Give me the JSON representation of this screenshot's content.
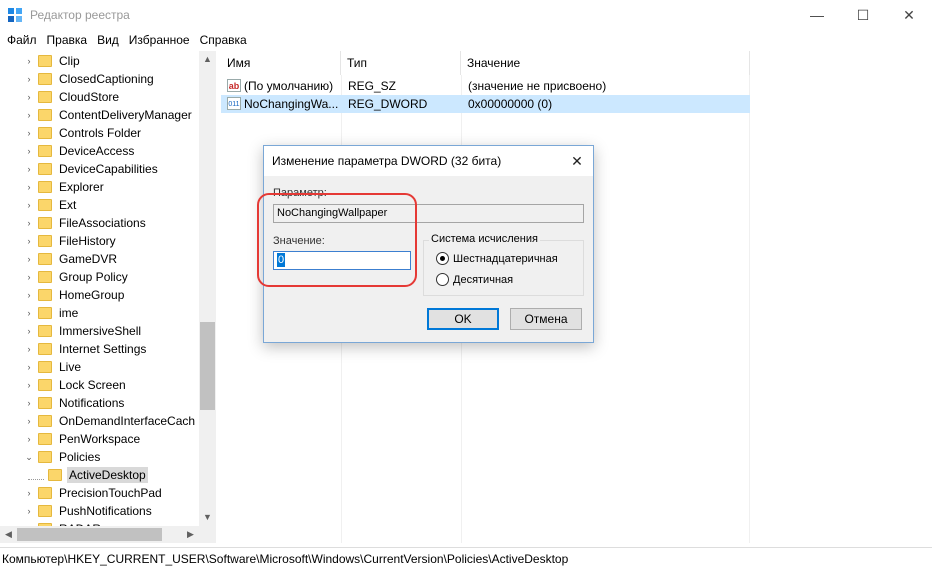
{
  "window": {
    "title": "Редактор реестра",
    "minimize_glyph": "—",
    "maximize_glyph": "☐",
    "close_glyph": "✕"
  },
  "menu": [
    "Файл",
    "Правка",
    "Вид",
    "Избранное",
    "Справка"
  ],
  "tree": {
    "items": [
      {
        "label": "Clip",
        "expander": "›"
      },
      {
        "label": "ClosedCaptioning",
        "expander": "›"
      },
      {
        "label": "CloudStore",
        "expander": "›"
      },
      {
        "label": "ContentDeliveryManager",
        "expander": "›"
      },
      {
        "label": "Controls Folder",
        "expander": "›"
      },
      {
        "label": "DeviceAccess",
        "expander": "›"
      },
      {
        "label": "DeviceCapabilities",
        "expander": "›"
      },
      {
        "label": "Explorer",
        "expander": "›"
      },
      {
        "label": "Ext",
        "expander": "›"
      },
      {
        "label": "FileAssociations",
        "expander": "›"
      },
      {
        "label": "FileHistory",
        "expander": "›"
      },
      {
        "label": "GameDVR",
        "expander": "›"
      },
      {
        "label": "Group Policy",
        "expander": "›"
      },
      {
        "label": "HomeGroup",
        "expander": "›"
      },
      {
        "label": "ime",
        "expander": "›"
      },
      {
        "label": "ImmersiveShell",
        "expander": "›"
      },
      {
        "label": "Internet Settings",
        "expander": "›"
      },
      {
        "label": "Live",
        "expander": "›"
      },
      {
        "label": "Lock Screen",
        "expander": "›"
      },
      {
        "label": "Notifications",
        "expander": "›"
      },
      {
        "label": "OnDemandInterfaceCach",
        "expander": "›"
      },
      {
        "label": "PenWorkspace",
        "expander": "›"
      },
      {
        "label": "Policies",
        "expander": "⌄"
      },
      {
        "label": "ActiveDesktop",
        "expander": "",
        "selected": true,
        "child": true
      },
      {
        "label": "PrecisionTouchPad",
        "expander": "›"
      },
      {
        "label": "PushNotifications",
        "expander": "›"
      },
      {
        "label": "RADAR",
        "expander": "›"
      }
    ]
  },
  "list": {
    "columns": [
      "Имя",
      "Тип",
      "Значение"
    ],
    "rows": [
      {
        "icon": "ab",
        "name": "(По умолчанию)",
        "type": "REG_SZ",
        "value": "(значение не присвоено)"
      },
      {
        "icon": "011",
        "name": "NoChangingWa...",
        "type": "REG_DWORD",
        "value": "0x00000000 (0)",
        "selected": true
      }
    ]
  },
  "status": "Компьютер\\HKEY_CURRENT_USER\\Software\\Microsoft\\Windows\\CurrentVersion\\Policies\\ActiveDesktop",
  "dialog": {
    "title": "Изменение параметра DWORD (32 бита)",
    "param_label": "Параметр:",
    "param_value": "NoChangingWallpaper",
    "value_label": "Значение:",
    "value": "0",
    "base_group": "Система исчисления",
    "radio_hex": "Шестнадцатеричная",
    "radio_dec": "Десятичная",
    "ok": "OK",
    "cancel": "Отмена",
    "close_glyph": "✕"
  }
}
